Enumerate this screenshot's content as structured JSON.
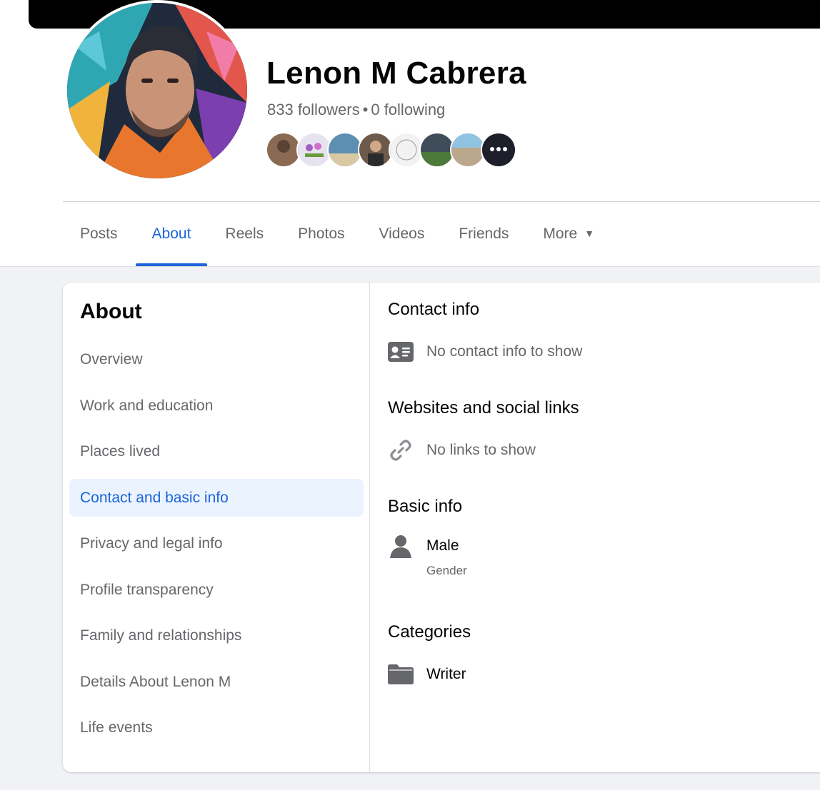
{
  "profile": {
    "name": "Lenon M Cabrera",
    "followers": "833 followers",
    "separator": "•",
    "following": "0 following"
  },
  "friend_avatar_colors": [
    "#8a6a52",
    "#e6e2ef",
    "#5d8fb3",
    "#6e5a4a",
    "#f2f2f2",
    "#3f4c5a",
    "#bba78c",
    "#1d1f2b"
  ],
  "tabs": [
    {
      "label": "Posts"
    },
    {
      "label": "About"
    },
    {
      "label": "Reels"
    },
    {
      "label": "Photos"
    },
    {
      "label": "Videos"
    },
    {
      "label": "Friends"
    },
    {
      "label": "More"
    }
  ],
  "about_nav": {
    "title": "About",
    "items": [
      {
        "label": "Overview"
      },
      {
        "label": "Work and education"
      },
      {
        "label": "Places lived"
      },
      {
        "label": "Contact and basic info"
      },
      {
        "label": "Privacy and legal info"
      },
      {
        "label": "Profile transparency"
      },
      {
        "label": "Family and relationships"
      },
      {
        "label": "Details About Lenon M"
      },
      {
        "label": "Life events"
      }
    ]
  },
  "content": {
    "contact": {
      "title": "Contact info",
      "empty": "No contact info to show"
    },
    "websites": {
      "title": "Websites and social links",
      "empty": "No links to show"
    },
    "basic": {
      "title": "Basic info",
      "value": "Male",
      "label": "Gender"
    },
    "categories": {
      "title": "Categories",
      "value": "Writer"
    }
  },
  "colors": {
    "accent": "#1b64da",
    "active_bg": "#ebf3ff",
    "secondary_text": "#65676b",
    "icon_gray": "#65676b"
  },
  "icons": {
    "contact": "contact-card-icon",
    "links": "link-icon",
    "gender": "person-icon",
    "category": "folder-icon",
    "more": "caret-down-icon"
  }
}
